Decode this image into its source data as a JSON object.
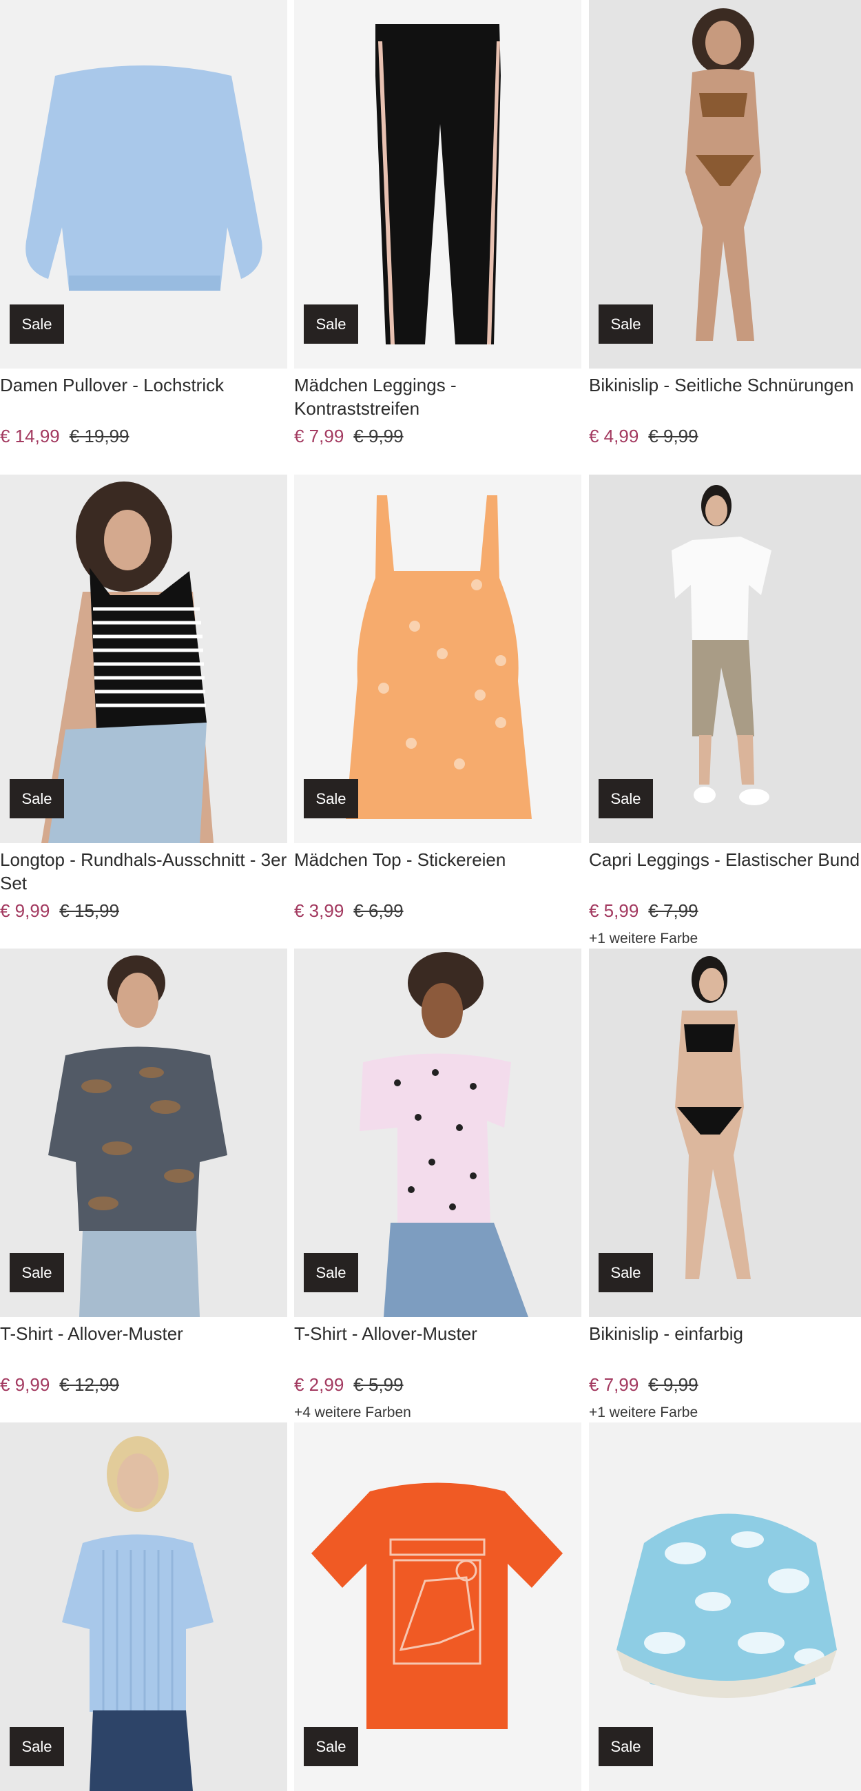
{
  "products": [
    {
      "title": "Damen Pullover - Lochstrick",
      "price": "€ 14,99",
      "old_price": "€ 19,99",
      "badge": "Sale",
      "more_colors": "",
      "image": "light-blue-knit-sweater"
    },
    {
      "title": "Mädchen Leggings - Kontraststreifen",
      "price": "€ 7,99",
      "old_price": "€ 9,99",
      "badge": "Sale",
      "more_colors": "",
      "image": "black-leggings-contrast-stripe"
    },
    {
      "title": "Bikinislip - Seitliche Schnürungen",
      "price": "€ 4,99",
      "old_price": "€ 9,99",
      "badge": "Sale",
      "more_colors": "",
      "image": "model-leopard-bikini"
    },
    {
      "title": "Longtop - Rundhals-Ausschnitt - 3er Set",
      "price": "€ 9,99",
      "old_price": "€ 15,99",
      "badge": "Sale",
      "more_colors": "",
      "image": "model-striped-tank-top"
    },
    {
      "title": "Mädchen Top - Stickereien",
      "price": "€ 3,99",
      "old_price": "€ 6,99",
      "badge": "Sale",
      "more_colors": "",
      "image": "orange-embroidered-top"
    },
    {
      "title": "Capri Leggings - Elastischer Bund",
      "price": "€ 5,99",
      "old_price": "€ 7,99",
      "badge": "Sale",
      "more_colors": "+1 weitere Farbe",
      "image": "model-capri-leggings"
    },
    {
      "title": "T-Shirt - Allover-Muster",
      "price": "€ 9,99",
      "old_price": "€ 12,99",
      "badge": "Sale",
      "more_colors": "",
      "image": "model-leaf-print-tshirt"
    },
    {
      "title": "T-Shirt - Allover-Muster",
      "price": "€ 2,99",
      "old_price": "€ 5,99",
      "badge": "Sale",
      "more_colors": "+4 weitere Farben",
      "image": "model-butterfly-print-tshirt"
    },
    {
      "title": "Bikinislip - einfarbig",
      "price": "€ 7,99",
      "old_price": "€ 9,99",
      "badge": "Sale",
      "more_colors": "+1 weitere Farbe",
      "image": "model-black-bikini"
    },
    {
      "title": "",
      "price": "",
      "old_price": "",
      "badge": "Sale",
      "more_colors": "",
      "image": "model-blue-ribbed-tshirt"
    },
    {
      "title": "",
      "price": "",
      "old_price": "",
      "badge": "Sale",
      "more_colors": "",
      "image": "orange-dinosaur-tshirt"
    },
    {
      "title": "",
      "price": "",
      "old_price": "",
      "badge": "Sale",
      "more_colors": "",
      "image": "tie-dye-bucket-hat"
    }
  ],
  "colors": {
    "sale_badge": "#262221",
    "price": "#a33a60",
    "text": "#2b2b2b",
    "image_bg": "#efefef"
  }
}
